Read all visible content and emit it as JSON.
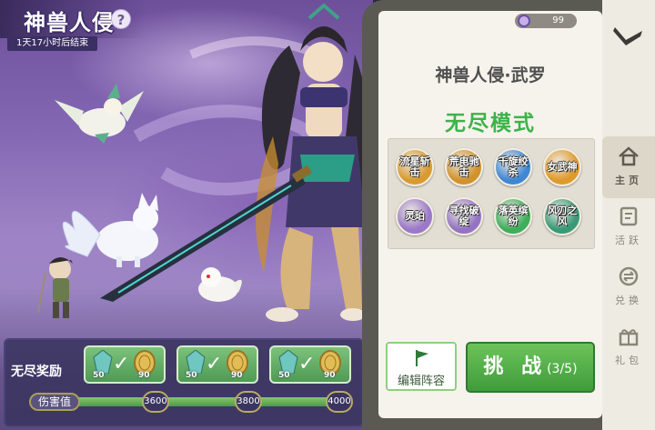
{
  "event": {
    "title": "神兽人侵",
    "help_icon": "?",
    "timer": "1天17小时后结束"
  },
  "boss": {
    "power": "99",
    "name": "神兽人侵·武罗",
    "mode": "无尽模式"
  },
  "skills": [
    {
      "label": "流星斩击",
      "color": "#d99a2f"
    },
    {
      "label": "荒电驰击",
      "color": "#d1922c"
    },
    {
      "label": "千旋绞杀",
      "color": "#3f86d4"
    },
    {
      "label": "女武神",
      "color": "#e09a2b"
    },
    {
      "label": "灵珀",
      "color": "#9b78c8"
    },
    {
      "label": "寻找破绽",
      "color": "#9474c2"
    },
    {
      "label": "落英缤纷",
      "color": "#3fae5b"
    },
    {
      "label": "风刃之风",
      "color": "#3a9a78"
    }
  ],
  "buttons": {
    "edit": "编辑阵容",
    "challenge": "挑 战",
    "challenge_count": "(3/5)"
  },
  "rewards": {
    "label": "无尽奖励",
    "damage_label": "伤害值",
    "chests": [
      {
        "gem": "50",
        "coin": "90"
      },
      {
        "gem": "50",
        "coin": "90"
      },
      {
        "gem": "50",
        "coin": "90"
      }
    ],
    "milestones": [
      "3600",
      "3800",
      "4000"
    ],
    "progress_fraction": 0.96
  },
  "nav": {
    "home": "主页",
    "activity": "活跃",
    "exchange": "兑换",
    "gift": "礼包"
  }
}
